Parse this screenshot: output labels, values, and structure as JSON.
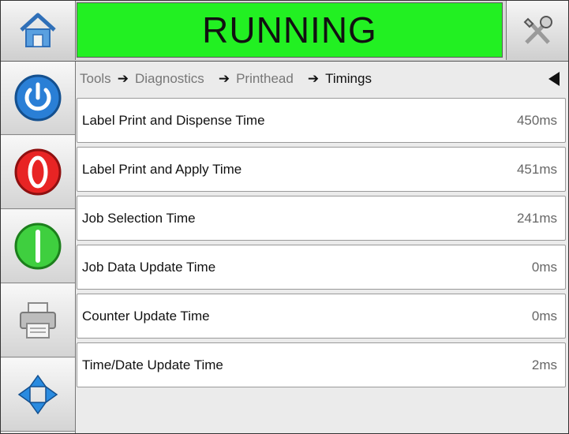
{
  "header": {
    "status": "RUNNING",
    "status_color": "#22f022",
    "home_icon": "home-icon",
    "tools_icon": "tools-icon"
  },
  "sidebar": {
    "items": [
      {
        "name": "power",
        "icon": "power-icon"
      },
      {
        "name": "stop",
        "icon": "stop-icon"
      },
      {
        "name": "start",
        "icon": "start-icon"
      },
      {
        "name": "print",
        "icon": "printer-icon"
      },
      {
        "name": "navigate",
        "icon": "navigation-arrows-icon"
      }
    ]
  },
  "breadcrumb": {
    "items": [
      "Tools",
      "Diagnostics",
      "Printhead",
      "Timings"
    ],
    "collapse_icon": "triangle-left-icon"
  },
  "timings": [
    {
      "label": "Label Print and Dispense Time",
      "value": "450ms"
    },
    {
      "label": "Label Print and Apply Time",
      "value": "451ms"
    },
    {
      "label": "Job Selection Time",
      "value": "241ms"
    },
    {
      "label": "Job Data Update Time",
      "value": "0ms"
    },
    {
      "label": "Counter Update Time",
      "value": "0ms"
    },
    {
      "label": "Time/Date Update Time",
      "value": "2ms"
    }
  ]
}
